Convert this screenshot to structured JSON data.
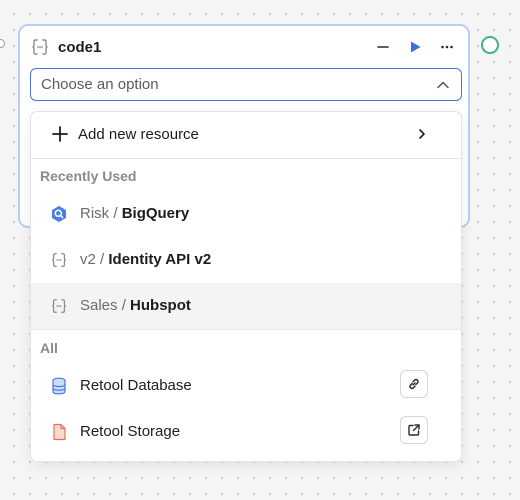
{
  "node": {
    "title": "code1"
  },
  "select": {
    "placeholder": "Choose an option"
  },
  "dropdown": {
    "add_label": "Add new resource",
    "recent_label": "Recently Used",
    "recent_items": [
      {
        "prefix": "Risk",
        "separator": "/",
        "name": "BigQuery",
        "icon": "bigquery-icon"
      },
      {
        "prefix": "v2",
        "separator": "/",
        "name": "Identity API v2",
        "icon": "braces-icon"
      },
      {
        "prefix": "Sales",
        "separator": "/",
        "name": "Hubspot",
        "icon": "braces-icon"
      }
    ],
    "all_label": "All",
    "all_items": [
      {
        "name": "Retool Database",
        "icon": "database-icon",
        "action_icon": "link-icon"
      },
      {
        "name": "Retool Storage",
        "icon": "file-icon",
        "action_icon": "external-link-icon"
      }
    ]
  },
  "colors": {
    "accent": "#4a74e2",
    "run": "#3d6fe0",
    "status_port": "#3fb37f",
    "storage": "#e0735a",
    "bigquery": "#4a7fe6"
  }
}
